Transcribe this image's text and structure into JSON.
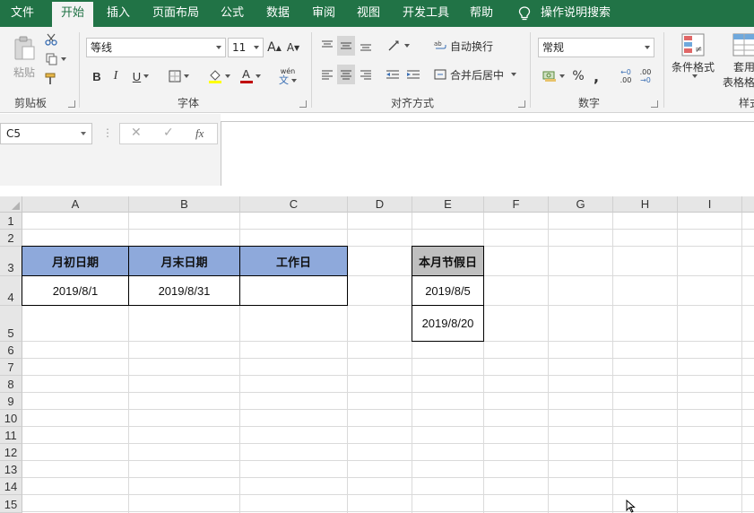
{
  "ribbon": {
    "tabs": [
      "文件",
      "开始",
      "插入",
      "页面布局",
      "公式",
      "数据",
      "审阅",
      "视图",
      "开发工具",
      "帮助"
    ],
    "active_tab": "开始",
    "tell_me": "操作说明搜索",
    "clipboard": {
      "paste_label": "粘贴",
      "group_label": "剪贴板"
    },
    "font": {
      "name": "等线",
      "size": "11",
      "group_label": "字体",
      "increase": "A",
      "decrease": "A",
      "bold": "B",
      "italic": "I",
      "underline": "U",
      "font_color_glyph": "A",
      "phonetic_top": "wén",
      "phonetic_bottom": "文"
    },
    "alignment": {
      "wrap_text": "自动换行",
      "merge_center": "合并后居中",
      "group_label": "对齐方式"
    },
    "number": {
      "format": "常规",
      "percent": "%",
      "comma": ",",
      "inc_decimal": ".00",
      "dec_decimal": ".00",
      "group_label": "数字"
    },
    "styles": {
      "conditional_format": "条件格式",
      "table_format": "套用",
      "table_format_line2": "表格格式",
      "group_label": "样式"
    }
  },
  "formula_bar": {
    "name_box": "C5",
    "cancel": "✕",
    "enter": "✓",
    "fx": "fx",
    "content": ""
  },
  "sheet": {
    "columns": [
      "A",
      "B",
      "C",
      "D",
      "E",
      "F",
      "G",
      "H",
      "I"
    ],
    "rows": [
      "1",
      "2",
      "3",
      "4",
      "5",
      "6",
      "7",
      "8",
      "9",
      "10",
      "11",
      "12",
      "13",
      "14",
      "15"
    ],
    "cells": {
      "A3": "月初日期",
      "B3": "月末日期",
      "C3": "工作日",
      "A4": "2019/8/1",
      "B4": "2019/8/31",
      "C4": "",
      "E3": "本月节假日",
      "E4": "2019/8/5",
      "E5": "2019/8/20"
    },
    "colors": {
      "header_blue": "#8ea9db",
      "header_grey": "#bfbfbf",
      "ribbon_green": "#217346"
    }
  }
}
